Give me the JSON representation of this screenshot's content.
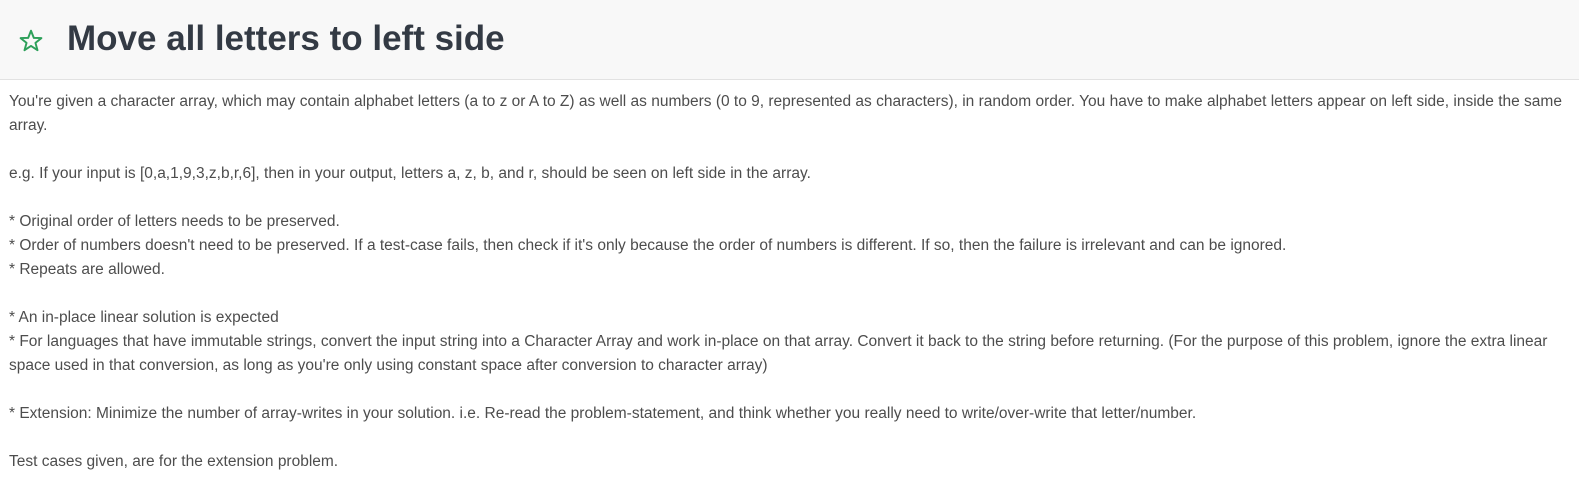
{
  "problem": {
    "title": "Move all letters to left side",
    "favorite_icon": "star-outline-icon",
    "accent_color": "#2da05a",
    "paragraphs": [
      [
        "You're given a character array, which may contain alphabet letters (a to z or A to Z) as well as numbers (0 to 9, represented as characters), in random order. You have to make alphabet letters appear on left side, inside the same array."
      ],
      [
        "e.g. If your input is [0,a,1,9,3,z,b,r,6], then in your output, letters a, z, b, and r, should be seen on left side in the array."
      ],
      [
        "* Original order of letters needs to be preserved.",
        "* Order of numbers doesn't need to be preserved. If a test-case fails, then check if it's only because the order of numbers is different. If so, then the failure is irrelevant and can be ignored.",
        "* Repeats are allowed."
      ],
      [
        "* An in-place linear solution is expected",
        "* For languages that have immutable strings, convert the input string into a Character Array and work in-place on that array. Convert it back to the string before returning. (For the purpose of this problem, ignore the extra linear space used in that conversion, as long as you're only using constant space after conversion to character array)"
      ],
      [
        "* Extension: Minimize the number of array-writes in your solution. i.e. Re-read the problem-statement, and think whether you really need to write/over-write that letter/number."
      ],
      [
        "Test cases given, are for the extension problem."
      ]
    ]
  }
}
